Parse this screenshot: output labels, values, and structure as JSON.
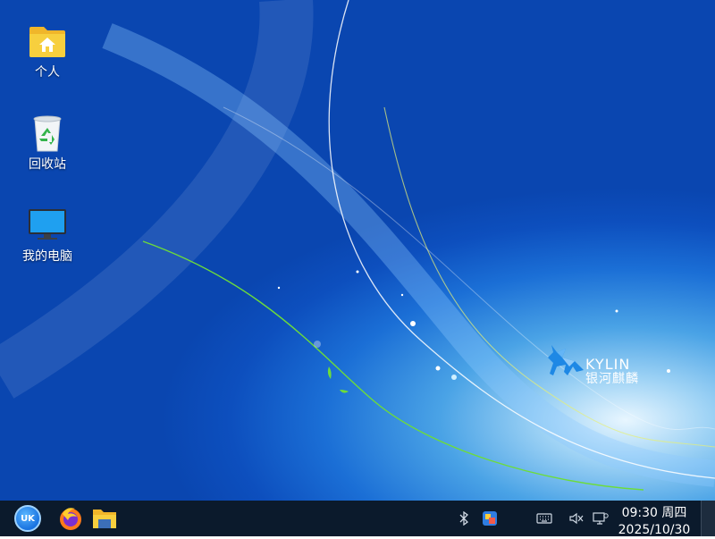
{
  "desktop": {
    "icons": [
      {
        "label": "个人",
        "icon": "home-folder-icon"
      },
      {
        "label": "回收站",
        "icon": "recycle-bin-icon"
      },
      {
        "label": "我的电脑",
        "icon": "computer-icon"
      }
    ]
  },
  "wallpaper": {
    "brand_en": "KYLIN",
    "brand_cn": "银河麒麟"
  },
  "taskbar": {
    "start_icon": "uk-logo-icon",
    "start_text": "UK",
    "apps": [
      {
        "name": "firefox",
        "icon": "firefox-icon"
      },
      {
        "name": "files",
        "icon": "file-manager-icon"
      }
    ],
    "tray": [
      "bluetooth-icon",
      "app-tray-icon",
      "keyboard-icon",
      "volume-muted-icon",
      "network-icon"
    ],
    "clock_time": "09:30 周四",
    "clock_date": "2025/10/30"
  },
  "colors": {
    "taskbar_bg": "#0b1a2c",
    "wallpaper_blue": "#0d4fbe",
    "accent": "#1a73e0"
  }
}
